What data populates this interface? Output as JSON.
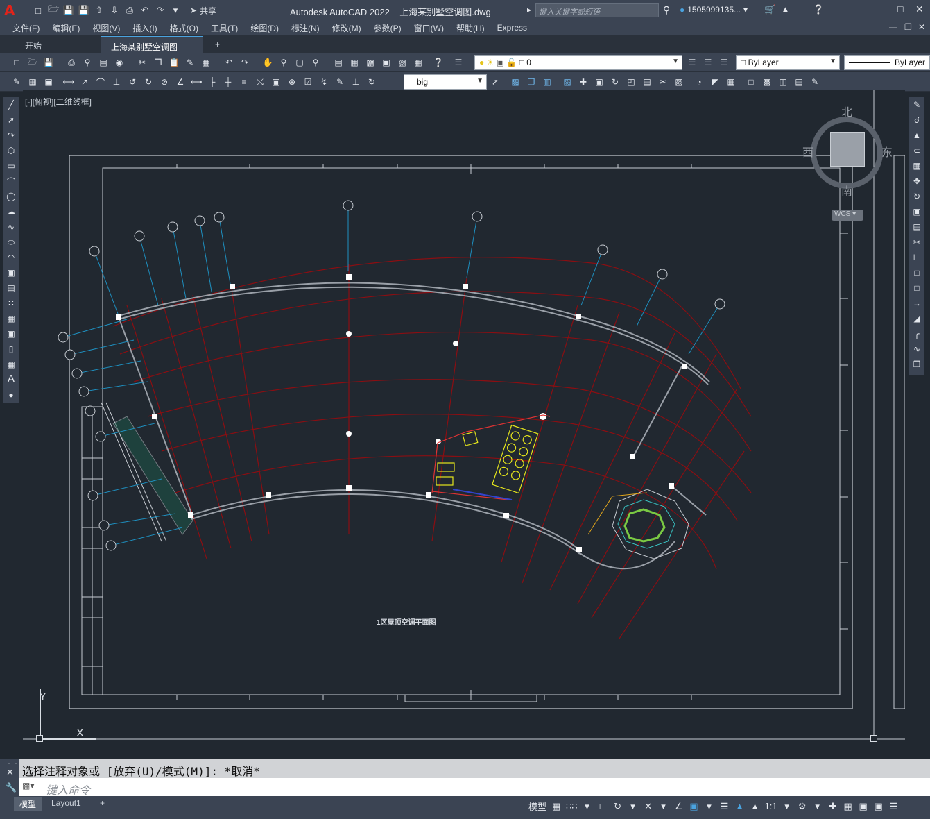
{
  "app": {
    "logo": "A",
    "title": "Autodesk AutoCAD 2022",
    "file": "上海某别墅空调图.dwg",
    "search_placeholder": "键入关键字或短语",
    "user": "1505999135...",
    "share": "共享"
  },
  "menu": [
    "文件(F)",
    "编辑(E)",
    "视图(V)",
    "插入(I)",
    "格式(O)",
    "工具(T)",
    "绘图(D)",
    "标注(N)",
    "修改(M)",
    "参数(P)",
    "窗口(W)",
    "帮助(H)",
    "Express"
  ],
  "tabs": {
    "start": "开始",
    "drawing": "上海某别墅空调图*",
    "add": "+"
  },
  "toolbar": {
    "layer_value": "0",
    "color_value": "ByLayer",
    "linetype_value": "ByLayer",
    "dimstyle_value": "big"
  },
  "viewport": {
    "label": "[-][俯视][二维线框]",
    "compass": {
      "north": "北",
      "south": "南",
      "east": "东",
      "west": "西",
      "wcs": "WCS"
    },
    "ucs_x": "X",
    "ucs_y": "Y",
    "drawing_title": "1区屋顶空调平面图"
  },
  "command": {
    "history": "选择注释对象或 [放弃(U)/模式(M)]: *取消*",
    "placeholder": "键入命令"
  },
  "status": {
    "model_tab": "模型",
    "layout_tab": "Layout1",
    "model_btn": "模型",
    "scale": "1:1"
  },
  "colors": {
    "background": "#212830",
    "chrome": "#3b4453",
    "grid_red": "#8b0e12",
    "wall_gray": "#9aa0a8",
    "leader_cyan": "#1e8fbf",
    "equip_yellow": "#e5e51c"
  }
}
